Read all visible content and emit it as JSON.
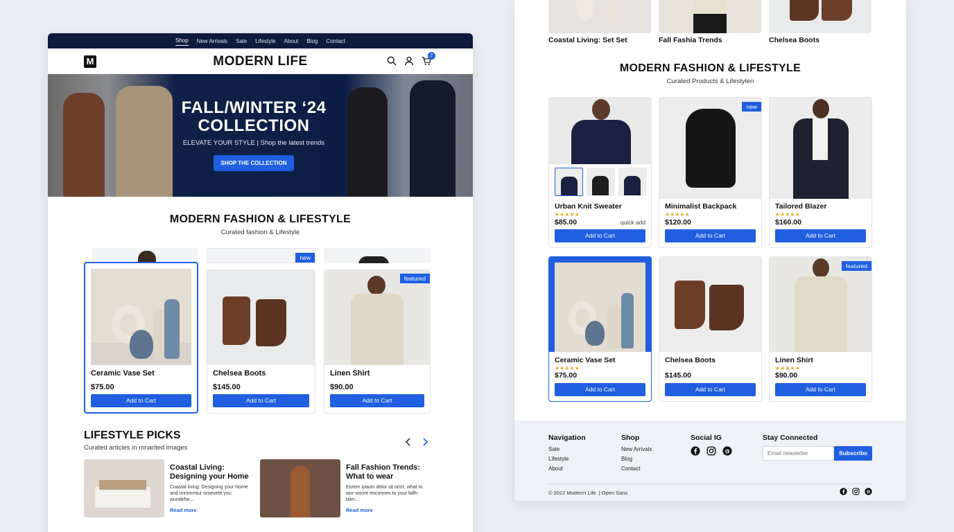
{
  "left": {
    "nav": [
      "Shop",
      "New Arrivals",
      "Sale",
      "Lifestyle",
      "About",
      "Blog",
      "Contact"
    ],
    "logo_letter": "M",
    "brand": "MODERN LIFE",
    "cart_count": "2",
    "hero": {
      "title_line1": "FALL/WINTER ‘24",
      "title_line2": "COLLECTION",
      "subtitle": "ELEVATE YOUR STYLE | Shop the latest trends",
      "cta": "SHOP THE COLLECTION"
    },
    "section": {
      "title": "MODERN FASHION & LIFESTYLE",
      "subtitle": "Curated fashion & Lifestyle"
    },
    "products": [
      {
        "name": "Ceramic Vase Set",
        "price": "$75.00",
        "button": "Add to Cart",
        "tag": ""
      },
      {
        "name": "Chelsea Boots",
        "price": "$145.00",
        "button": "Add to Cart",
        "tag": "new"
      },
      {
        "name": "Linen Shirt",
        "price": "$90.00",
        "button": "Add to Cart",
        "tag": "featured"
      }
    ],
    "lifestyle": {
      "title": "LIFESTYLE PICKS",
      "subtitle": "Curated articles in mnarited images",
      "articles": [
        {
          "title": "Coastal Living: Designing your Home",
          "excerpt": "Coastal living: Designing your Nome and minimmtur oroevete you wundirhe...",
          "link": "Read more"
        },
        {
          "title": "Fall Fashion Trends: What to wear",
          "excerpt": "Eorem ipaum delor sit omrt, what to wor woore enconoes to your fallh-blim...",
          "link": "Read more"
        }
      ]
    }
  },
  "right": {
    "top_tiles": [
      "Coastal Living: Set Set",
      "Fall Fashia Trends",
      "Chelsea Boots"
    ],
    "section": {
      "title": "MODERN FASHION & LIFESTYLE",
      "subtitle": "Curated Products & Lifestylen"
    },
    "products": [
      {
        "name": "Urban Knit Sweater",
        "price": "$85.00",
        "stars": "★★★★★",
        "button": "Add to Cart",
        "tag": "",
        "extra": "quick add"
      },
      {
        "name": "Minimalist Backpack",
        "price": "$120.00",
        "stars": "★★★★★",
        "button": "Add to Cart",
        "tag": "new",
        "extra": ""
      },
      {
        "name": "Tailored Blazer",
        "price": "$160.00",
        "stars": "★★★★★",
        "button": "Add to Cart",
        "tag": "",
        "extra": ""
      },
      {
        "name": "Ceramic Vase Set",
        "price": "$75.00",
        "stars": "★★★★★",
        "button": "Add to Cart",
        "tag": "",
        "extra": ""
      },
      {
        "name": "Chelsea Boots",
        "price": "$145.00",
        "stars": "",
        "button": "Add to Cart",
        "tag": "",
        "extra": ""
      },
      {
        "name": "Linen Shirt",
        "price": "$90.00",
        "stars": "★★★★★",
        "button": "Add to Cart",
        "tag": "featured",
        "extra": ""
      }
    ],
    "footer": {
      "nav_head": "Navigation",
      "nav_links": [
        "Sale",
        "Lifestyle",
        "About"
      ],
      "shop_head": "Shop",
      "shop_links": [
        "New Arrivals",
        "Blog",
        "Contact"
      ],
      "social_head": "Social IG",
      "newsletter_head": "Stay Connected",
      "newsletter_placeholder": "Email newsletter",
      "subscribe": "Subscribe",
      "copyright": "© 2022 Moderrn Life. | Open Sans"
    }
  },
  "colors": {
    "accent": "#1f5fe0",
    "navy": "#0e1b3d",
    "star": "#e8a815",
    "footer_bg": "#eef1f6"
  }
}
